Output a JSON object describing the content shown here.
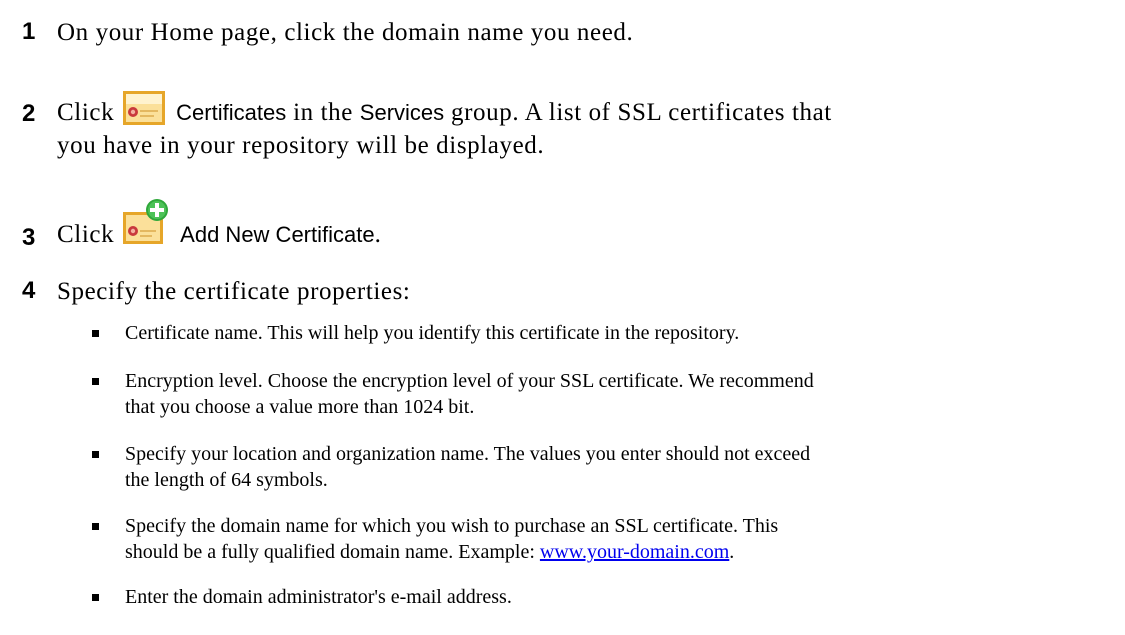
{
  "steps": [
    {
      "number": "1",
      "text": "On your Home page, click the domain name you need."
    },
    {
      "number": "2",
      "lead": "Click",
      "icon": "certificate-icon",
      "ui_label": "Certificates",
      "mid": "in the",
      "ui_group": "Services",
      "rest_line1": "group. A list of SSL certificates that",
      "rest_line2": "you have in your repository will be displayed."
    },
    {
      "number": "3",
      "lead": "Click",
      "icon": "add-certificate-icon",
      "ui_label": "Add New Certificate",
      "tail": "."
    },
    {
      "number": "4",
      "text": "Specify the certificate properties:"
    }
  ],
  "properties": [
    {
      "text": "Certificate name. This will help you identify this certificate in the repository."
    },
    {
      "line1": "Encryption level. Choose the encryption level of your SSL certificate. We recommend",
      "line2": "that you choose a value more than 1024 bit."
    },
    {
      "line1": "Specify your location and organization name. The values you enter should not exceed",
      "line2": "the length of 64 symbols."
    },
    {
      "line1": "Specify the domain name for which you wish to purchase an SSL certificate. This",
      "line2": "should be a fully qualified domain name. Example:",
      "link": "www.your-domain.com",
      "tail": "."
    },
    {
      "text": "Enter the domain administrator's e-mail address."
    }
  ],
  "colors": {
    "link": "#0000ee",
    "certificate_fill": "#f4c95d",
    "certificate_border": "#e0a020",
    "plus_badge": "#2fa83a"
  }
}
